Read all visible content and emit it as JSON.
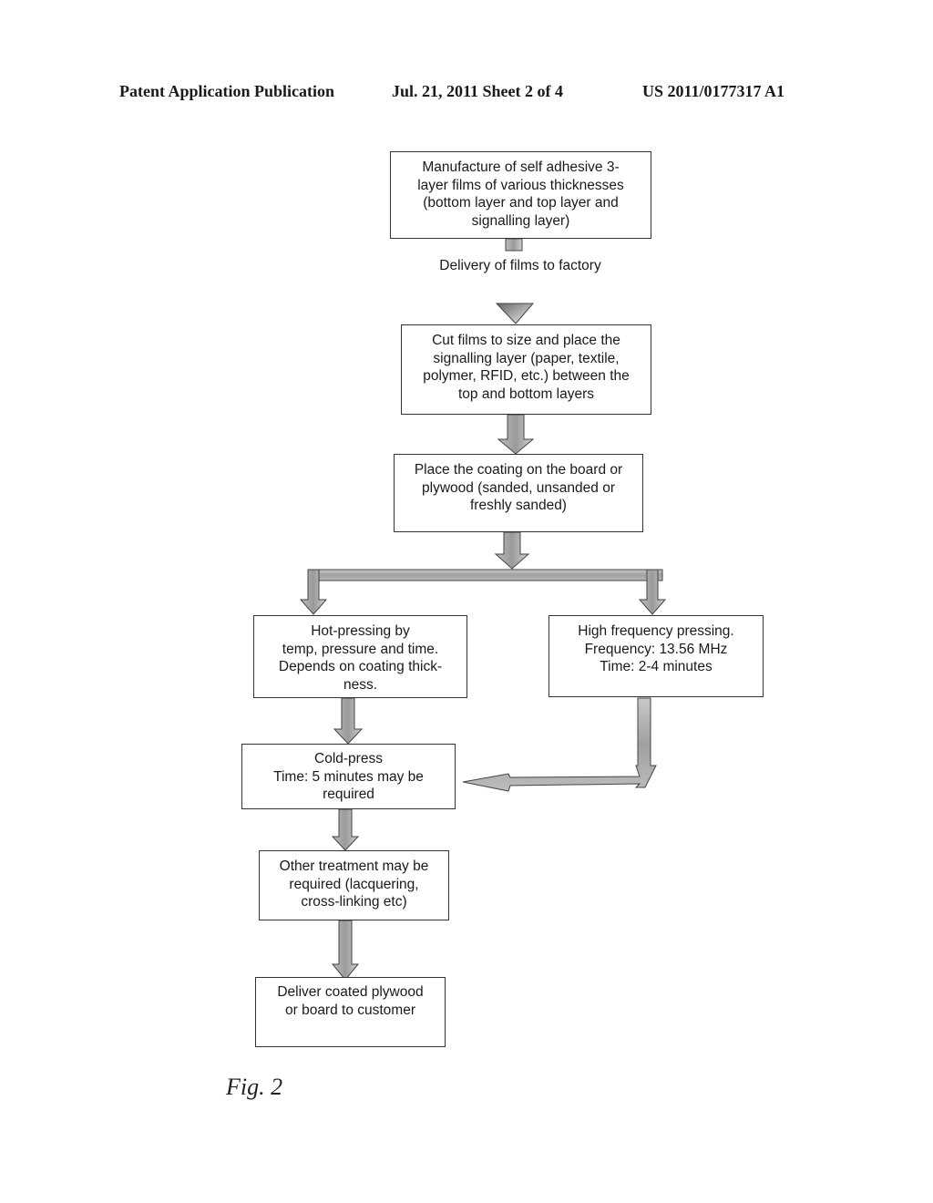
{
  "header": {
    "publication": "Patent Application Publication",
    "date_sheet": "Jul. 21, 2011   Sheet 2 of 4",
    "number": "US 2011/0177317 A1"
  },
  "flowchart": {
    "steps": [
      {
        "id": "manufacture",
        "text": "Manufacture of self adhesive 3-\nlayer films of various thicknesses\n(bottom layer and top layer and\nsignalling layer)"
      },
      {
        "id": "cut",
        "text": "Cut films to size and place the\nsignalling layer (paper, textile,\npolymer, RFID, etc.) between the\ntop and bottom layers"
      },
      {
        "id": "place",
        "text": "Place the coating on the board or\nplywood (sanded, unsanded or\nfreshly sanded)"
      },
      {
        "id": "hot-press",
        "text": "Hot-pressing by\ntemp, pressure and time.\nDepends on coating thick-\nness."
      },
      {
        "id": "hf-press",
        "text": "High frequency pressing.\nFrequency: 13.56 MHz\nTime: 2-4 minutes"
      },
      {
        "id": "cold-press",
        "text": "Cold-press\nTime: 5 minutes may be\nrequired"
      },
      {
        "id": "other",
        "text": "Other treatment may be\nrequired (lacquering,\ncross-linking etc)"
      },
      {
        "id": "deliver",
        "text": "Deliver coated plywood\nor board to customer"
      }
    ],
    "connector_label": "Delivery of films to factory",
    "edges": [
      [
        "manufacture",
        "cut"
      ],
      [
        "cut",
        "place"
      ],
      [
        "place",
        "hot-press"
      ],
      [
        "place",
        "hf-press"
      ],
      [
        "hot-press",
        "cold-press"
      ],
      [
        "hf-press",
        "cold-press"
      ],
      [
        "cold-press",
        "other"
      ],
      [
        "other",
        "deliver"
      ]
    ]
  },
  "figure_label": "Fig. 2"
}
